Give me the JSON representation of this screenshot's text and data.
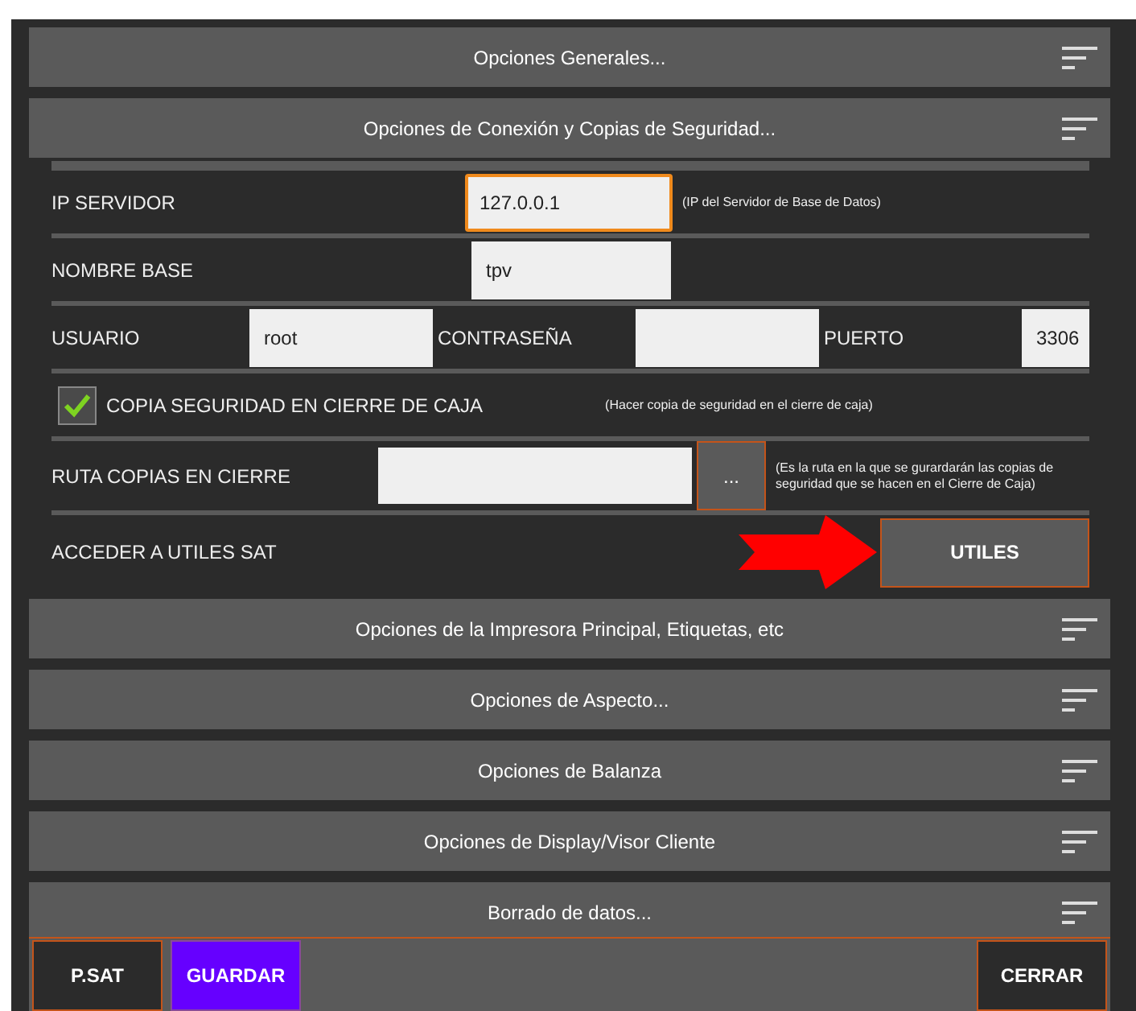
{
  "sections": [
    {
      "title": "Opciones Generales..."
    },
    {
      "title": "Opciones de Conexión y Copias de Seguridad...",
      "rows": [
        {
          "items": [
            {
              "kind": "label",
              "text": "IP SERVIDOR"
            },
            {
              "kind": "input",
              "value": "127.0.0.1",
              "focused": true
            },
            {
              "kind": "note",
              "text": "(IP del Servidor de Base de Datos)"
            }
          ]
        },
        {
          "items": [
            {
              "kind": "label",
              "text": "NOMBRE BASE"
            },
            {
              "kind": "input",
              "value": "tpv",
              "focused": false
            }
          ]
        },
        {
          "items": [
            {
              "kind": "label",
              "text": "USUARIO"
            },
            {
              "kind": "input",
              "value": "root",
              "focused": false
            },
            {
              "kind": "label",
              "text": "CONTRASEÑA"
            },
            {
              "kind": "input",
              "value": "",
              "focused": false
            },
            {
              "kind": "label",
              "text": "PUERTO"
            },
            {
              "kind": "input",
              "value": "3306",
              "focused": false
            }
          ]
        },
        {
          "items": [
            {
              "kind": "checkbox",
              "text": "COPIA SEGURIDAD EN CIERRE DE CAJA",
              "checked": true
            },
            {
              "kind": "note",
              "text": "(Hacer copia de seguridad en el cierre de caja)"
            }
          ]
        },
        {
          "items": [
            {
              "kind": "label",
              "text": "RUTA COPIAS EN CIERRE"
            },
            {
              "kind": "input",
              "value": "",
              "focused": false
            },
            {
              "kind": "browse",
              "text": "..."
            },
            {
              "kind": "note",
              "text": "(Es la ruta en la que se gurardarán las copias de seguridad que se hacen en el Cierre de Caja)"
            }
          ]
        },
        {
          "items": [
            {
              "kind": "label",
              "text": "ACCEDER A UTILES SAT"
            },
            {
              "kind": "button",
              "text": "UTILES"
            }
          ]
        }
      ]
    },
    {
      "title": "Opciones de la Impresora Principal, Etiquetas, etc"
    },
    {
      "title": "Opciones de Aspecto..."
    },
    {
      "title": "Opciones de Balanza"
    },
    {
      "title": "Opciones de Display/Visor Cliente"
    },
    {
      "title": "Borrado de datos..."
    }
  ],
  "footer": [
    {
      "text": "P.SAT",
      "primary": false
    },
    {
      "text": "GUARDAR",
      "primary": true
    },
    {
      "text": "CERRAR",
      "primary": false
    }
  ]
}
